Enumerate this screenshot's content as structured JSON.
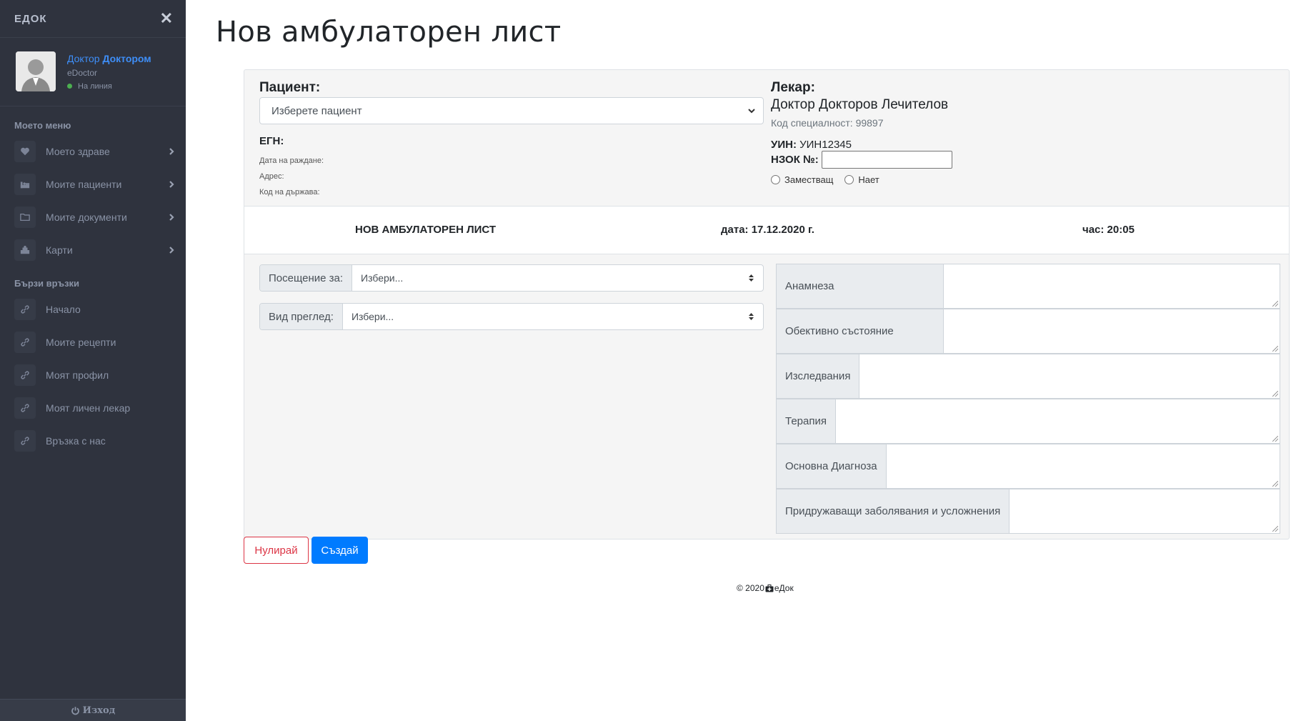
{
  "sidebar": {
    "brand": "ЕДОК",
    "user": {
      "prefix": "Доктор",
      "name": "Доктором",
      "role": "eDoctor",
      "status": "На линия"
    },
    "menu_title": "Моето меню",
    "menu": [
      {
        "label": "Моето здраве",
        "icon": "heart-icon"
      },
      {
        "label": "Моите пациенти",
        "icon": "patients-icon"
      },
      {
        "label": "Моите документи",
        "icon": "folder-icon"
      },
      {
        "label": "Карти",
        "icon": "map-icon"
      }
    ],
    "links_title": "Бързи връзки",
    "links": [
      {
        "label": "Начало",
        "icon": "link-icon"
      },
      {
        "label": "Моите рецепти",
        "icon": "link-icon"
      },
      {
        "label": "Моят профил",
        "icon": "link-icon"
      },
      {
        "label": "Моят личен лекар",
        "icon": "link-icon"
      },
      {
        "label": "Връзка с нас",
        "icon": "link-icon"
      }
    ],
    "logout": "Изход"
  },
  "page": {
    "title": "Нов амбулаторен лист"
  },
  "patient": {
    "label": "Пациент:",
    "select_value": "Изберете пациент",
    "egn": "ЕГН:",
    "birth_date": "Дата на раждане:",
    "address": "Адрес:",
    "country_code": "Код на държава:"
  },
  "doctor": {
    "label": "Лекар:",
    "name": "Доктор Докторов Лечителов",
    "specialty_code": "Код специалност: 99897",
    "uin_label": "УИН:",
    "uin_value": "УИН12345",
    "nzok_label": "НЗОК №:",
    "nzok_value": "",
    "radio_substitute": "Заместващ",
    "radio_hired": "Нает"
  },
  "band": {
    "title": "НОВ АМБУЛАТОРЕН ЛИСТ",
    "date": "дата: 17.12.2020 г.",
    "time": "час: 20:05"
  },
  "form": {
    "visit_label": "Посещение за:",
    "visit_value": "Избери...",
    "exam_label": "Вид преглед:",
    "exam_value": "Избери...",
    "textareas": [
      {
        "label": "Анамнеза"
      },
      {
        "label": "Обективно състояние"
      },
      {
        "label": "Изследвания"
      },
      {
        "label": "Терапия"
      },
      {
        "label": "Основна Диагноза"
      },
      {
        "label": "Придружаващи заболявания и усложнения"
      }
    ]
  },
  "buttons": {
    "reset": "Нулирай",
    "create": "Създай"
  },
  "footer": {
    "copyright": "© 2020",
    "brand": "еДок"
  },
  "colors": {
    "sidebar_bg": "#2f333e",
    "accent": "#007bff",
    "danger": "#dc3545",
    "user_link": "#3e8ef7"
  }
}
